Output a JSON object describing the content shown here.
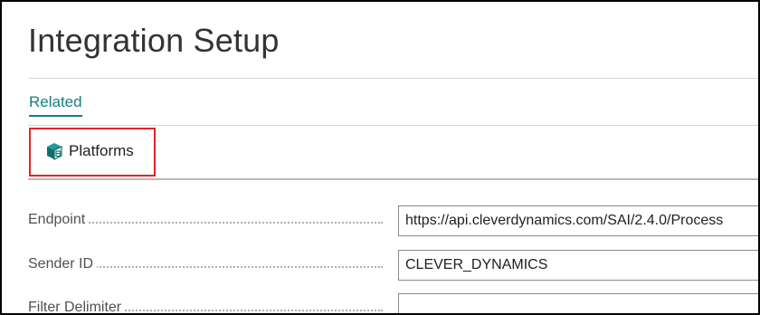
{
  "page": {
    "title": "Integration Setup"
  },
  "tabs": {
    "related_label": "Related"
  },
  "actions": {
    "platforms_label": "Platforms",
    "platforms_icon": "platforms-cube-icon"
  },
  "fields": [
    {
      "label": "Endpoint",
      "value": "https://api.cleverdynamics.com/SAI/2.4.0/Process"
    },
    {
      "label": "Sender ID",
      "value": "CLEVER_DYNAMICS"
    },
    {
      "label": "Filter Delimiter",
      "value": ""
    }
  ],
  "colors": {
    "accent": "#13807e",
    "highlight_box": "#e0242a",
    "icon_teal": "#0e7a7a"
  }
}
